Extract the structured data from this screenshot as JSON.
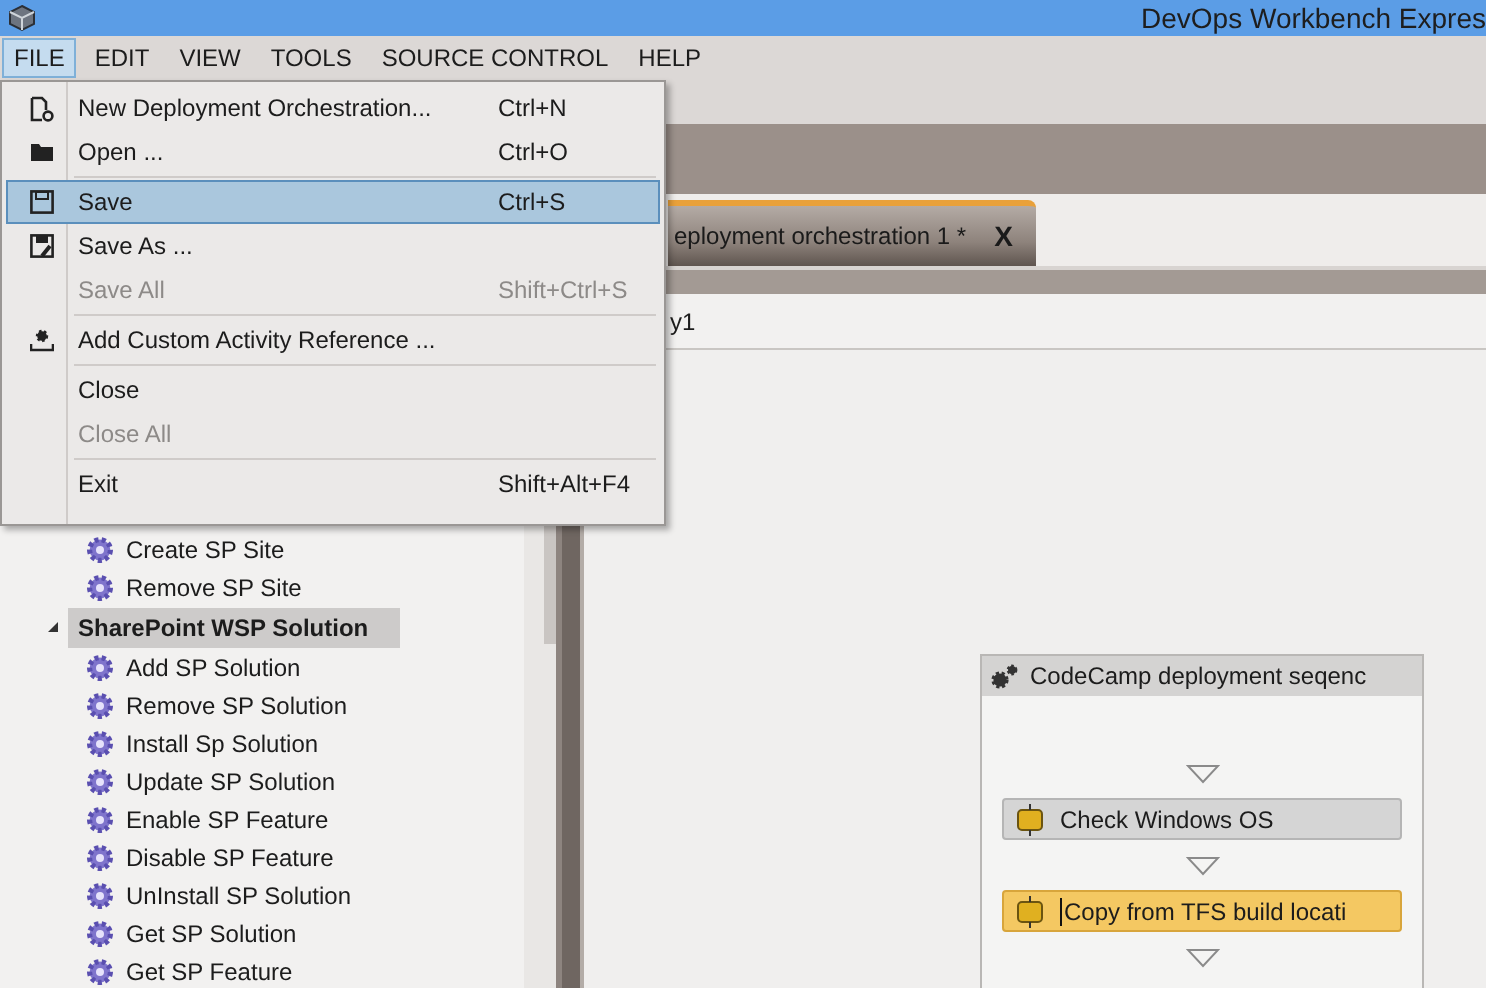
{
  "window": {
    "title": "DevOps Workbench Expres"
  },
  "menu_bar": [
    {
      "label": "FILE",
      "selected": true
    },
    {
      "label": "EDIT",
      "selected": false
    },
    {
      "label": "VIEW",
      "selected": false
    },
    {
      "label": "TOOLS",
      "selected": false
    },
    {
      "label": "SOURCE CONTROL",
      "selected": false
    },
    {
      "label": "HELP",
      "selected": false
    }
  ],
  "file_menu": [
    {
      "kind": "item",
      "label": "New Deployment Orchestration...",
      "shortcut": "Ctrl+N",
      "disabled": false,
      "selected": false
    },
    {
      "kind": "item",
      "label": "Open ...",
      "shortcut": "Ctrl+O",
      "disabled": false,
      "selected": false
    },
    {
      "kind": "separator"
    },
    {
      "kind": "item",
      "label": "Save",
      "shortcut": "Ctrl+S",
      "disabled": false,
      "selected": true
    },
    {
      "kind": "item",
      "label": "Save As ...",
      "disabled": false,
      "selected": false
    },
    {
      "kind": "item",
      "label": "Save All",
      "shortcut": "Shift+Ctrl+S",
      "disabled": true,
      "selected": false
    },
    {
      "kind": "separator"
    },
    {
      "kind": "item",
      "label": "Add Custom Activity Reference ...",
      "disabled": false,
      "selected": false
    },
    {
      "kind": "separator"
    },
    {
      "kind": "item",
      "label": "Close",
      "disabled": false,
      "selected": false
    },
    {
      "kind": "item",
      "label": "Close All",
      "disabled": true,
      "selected": false
    },
    {
      "kind": "separator"
    },
    {
      "kind": "item",
      "label": "Exit",
      "shortcut": "Shift+Alt+F4",
      "disabled": false,
      "selected": false
    }
  ],
  "tabs": [
    {
      "label": "eployment orchestration 1 *",
      "close": "X",
      "selected": true
    }
  ],
  "breadcrumb": "y1",
  "toolbox": {
    "items": [
      {
        "kind": "activity",
        "label": "Create SP Site",
        "selected": false
      },
      {
        "kind": "activity",
        "label": "Remove SP Site",
        "selected": false
      },
      {
        "kind": "group",
        "label": "SharePoint WSP Solution",
        "expanded": true,
        "selected": true,
        "children": [
          {
            "kind": "activity",
            "label": "Add SP Solution",
            "selected": false
          },
          {
            "kind": "activity",
            "label": "Remove SP Solution",
            "selected": false
          },
          {
            "kind": "activity",
            "label": "Install Sp Solution",
            "selected": false
          },
          {
            "kind": "activity",
            "label": "Update SP Solution",
            "selected": false
          },
          {
            "kind": "activity",
            "label": "Enable SP Feature",
            "selected": false
          },
          {
            "kind": "activity",
            "label": "Disable SP Feature",
            "selected": false
          },
          {
            "kind": "activity",
            "label": "UnInstall SP Solution",
            "selected": false
          },
          {
            "kind": "activity",
            "label": "Get SP Solution",
            "selected": false
          },
          {
            "kind": "activity",
            "label": "Get SP Feature",
            "selected": false
          }
        ]
      }
    ]
  },
  "sequence": {
    "title": "CodeCamp deployment seqenc",
    "activities": [
      {
        "label": "Check Windows OS",
        "selected": false
      },
      {
        "label": "Copy from TFS build locati",
        "selected": true
      }
    ]
  }
}
